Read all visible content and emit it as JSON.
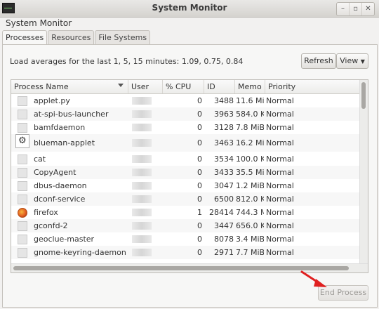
{
  "window": {
    "title": "System Monitor"
  },
  "menubar": {
    "app_label": "System Monitor"
  },
  "tabs": [
    {
      "label": "Processes",
      "active": true
    },
    {
      "label": "Resources",
      "active": false
    },
    {
      "label": "File Systems",
      "active": false
    }
  ],
  "processes_tab": {
    "load_averages": "Load averages for the last 1, 5, 15 minutes: 1.09, 0.75, 0.84",
    "refresh_label": "Refresh",
    "view_label": "View",
    "end_process_label": "End Process",
    "columns": [
      "Process Name",
      "User",
      "% CPU",
      "ID",
      "Memo",
      "Priority"
    ],
    "rows": [
      {
        "name": "applet.py",
        "cpu": "0",
        "id": "3488",
        "mem": "11.6 Mi",
        "priority": "Normal"
      },
      {
        "name": "at-spi-bus-launcher",
        "cpu": "0",
        "id": "3963",
        "mem": "584.0 K",
        "priority": "Normal"
      },
      {
        "name": "bamfdaemon",
        "cpu": "0",
        "id": "3128",
        "mem": "7.8 MiB",
        "priority": "Normal"
      },
      {
        "name": "blueman-applet",
        "cpu": "0",
        "id": "3463",
        "mem": "16.2 Mi",
        "priority": "Normal"
      },
      {
        "name": "cat",
        "cpu": "0",
        "id": "3534",
        "mem": "100.0 K",
        "priority": "Normal"
      },
      {
        "name": "CopyAgent",
        "cpu": "0",
        "id": "3433",
        "mem": "35.5 Mi",
        "priority": "Normal"
      },
      {
        "name": "dbus-daemon",
        "cpu": "0",
        "id": "3047",
        "mem": "1.2 MiB",
        "priority": "Normal"
      },
      {
        "name": "dconf-service",
        "cpu": "0",
        "id": "6500",
        "mem": "812.0 K",
        "priority": "Normal"
      },
      {
        "name": "firefox",
        "cpu": "1",
        "id": "28414",
        "mem": "744.3 M",
        "priority": "Normal"
      },
      {
        "name": "gconfd-2",
        "cpu": "0",
        "id": "3447",
        "mem": "656.0 K",
        "priority": "Normal"
      },
      {
        "name": "geoclue-master",
        "cpu": "0",
        "id": "8078",
        "mem": "3.4 MiB",
        "priority": "Normal"
      },
      {
        "name": "gnome-keyring-daemon",
        "cpu": "0",
        "id": "2971",
        "mem": "7.7 MiB",
        "priority": "Normal"
      }
    ]
  },
  "colors": {
    "annotation_arrow": "#e02020"
  }
}
